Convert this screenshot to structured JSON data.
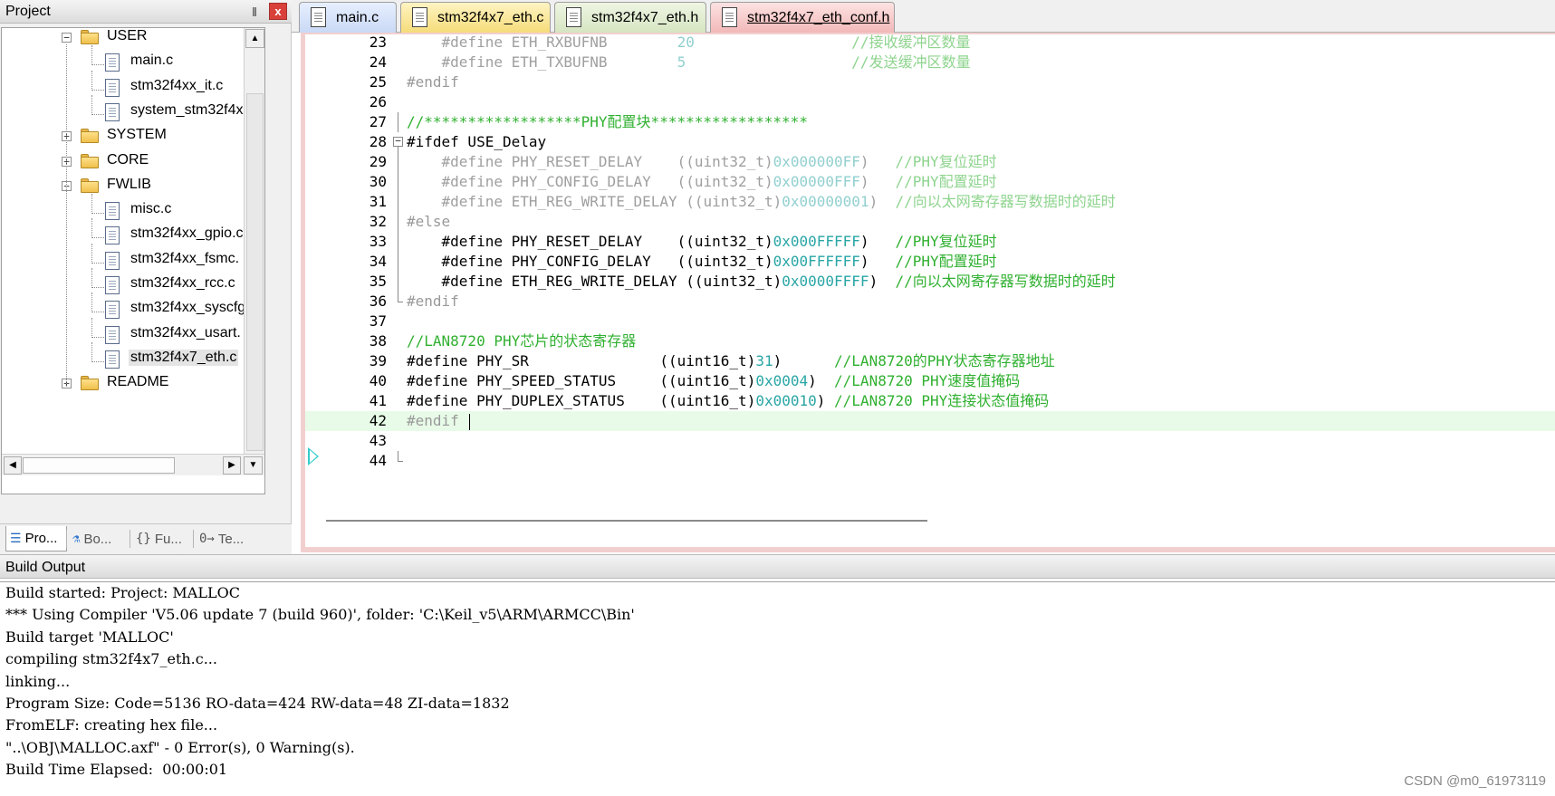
{
  "project_panel": {
    "title": "Project",
    "pin": "‖",
    "close": "x",
    "tree": [
      {
        "label": "USER",
        "type": "folder",
        "expanded": true
      },
      {
        "label": "main.c",
        "type": "file"
      },
      {
        "label": "stm32f4xx_it.c",
        "type": "file"
      },
      {
        "label": "system_stm32f4x",
        "type": "file"
      },
      {
        "label": "SYSTEM",
        "type": "folder",
        "expanded": false
      },
      {
        "label": "CORE",
        "type": "folder",
        "expanded": false
      },
      {
        "label": "FWLIB",
        "type": "folder",
        "expanded": true
      },
      {
        "label": "misc.c",
        "type": "file"
      },
      {
        "label": "stm32f4xx_gpio.c",
        "type": "file"
      },
      {
        "label": "stm32f4xx_fsmc.",
        "type": "file"
      },
      {
        "label": "stm32f4xx_rcc.c",
        "type": "file"
      },
      {
        "label": "stm32f4xx_syscfg",
        "type": "file"
      },
      {
        "label": "stm32f4xx_usart.",
        "type": "file"
      },
      {
        "label": "stm32f4x7_eth.c",
        "type": "file",
        "selected": true
      },
      {
        "label": "README",
        "type": "folder",
        "expanded": false
      }
    ],
    "bottom_tabs": [
      {
        "label": "Pro...",
        "icon": "project-icon",
        "active": true
      },
      {
        "label": "Bo...",
        "icon": "books-icon"
      },
      {
        "label": "Fu...",
        "icon": "functions-icon",
        "glyph": "{}"
      },
      {
        "label": "Te...",
        "icon": "templates-icon",
        "glyph": "0→"
      }
    ]
  },
  "editor": {
    "tabs": [
      {
        "label": "main.c"
      },
      {
        "label": "stm32f4x7_eth.c"
      },
      {
        "label": "stm32f4x7_eth.h"
      },
      {
        "label": "stm32f4x7_eth_conf.h",
        "active": true
      }
    ],
    "lines": [
      {
        "n": "23",
        "indent": "    ",
        "kw": "#define ETH_RXBUFNB",
        "pad": "        ",
        "val": "20",
        "pad2": "                  ",
        "cmt": "//接收缓冲区数量",
        "dim": true
      },
      {
        "n": "24",
        "indent": "    ",
        "kw": "#define ETH_TXBUFNB",
        "pad": "        ",
        "val": "5",
        "pad2": "                   ",
        "cmt": "//发送缓冲区数量",
        "dim": true
      },
      {
        "n": "25",
        "text": "#endif",
        "style": "pp"
      },
      {
        "n": "26",
        "text": ""
      },
      {
        "n": "27",
        "cmt": "//******************PHY配置块******************",
        "fold": "line"
      },
      {
        "n": "28",
        "text": "#ifdef USE_Delay",
        "style": "ppa",
        "fold": "box"
      },
      {
        "n": "29",
        "indent": "    ",
        "kw": "#define PHY_RESET_DELAY",
        "pad": "    ",
        "cast": "((uint32_t)",
        "val": "0x000000FF",
        "tail": ")",
        "pad2": "   ",
        "cmt": "//PHY复位延时",
        "dim": true,
        "fold": "line"
      },
      {
        "n": "30",
        "indent": "    ",
        "kw": "#define PHY_CONFIG_DELAY",
        "pad": "   ",
        "cast": "((uint32_t)",
        "val": "0x00000FFF",
        "tail": ")",
        "pad2": "   ",
        "cmt": "//PHY配置延时",
        "dim": true,
        "fold": "line"
      },
      {
        "n": "31",
        "indent": "    ",
        "kw": "#define ETH_REG_WRITE_DELAY",
        "pad": " ",
        "cast": "((uint32_t)",
        "val": "0x00000001",
        "tail": ")",
        "pad2": "  ",
        "cmt": "//向以太网寄存器写数据时的延时",
        "dim": true,
        "fold": "line"
      },
      {
        "n": "32",
        "text": "#else",
        "style": "pp",
        "fold": "line"
      },
      {
        "n": "33",
        "indent": "    ",
        "kw": "#define PHY_RESET_DELAY",
        "pad": "    ",
        "cast": "((uint32_t)",
        "val": "0x000FFFFF",
        "tail": ")",
        "pad2": "   ",
        "cmt": "//PHY复位延时",
        "fold": "line"
      },
      {
        "n": "34",
        "indent": "    ",
        "kw": "#define PHY_CONFIG_DELAY",
        "pad": "   ",
        "cast": "((uint32_t)",
        "val": "0x00FFFFFF",
        "tail": ")",
        "pad2": "   ",
        "cmt": "//PHY配置延时",
        "fold": "line"
      },
      {
        "n": "35",
        "indent": "    ",
        "kw": "#define ETH_REG_WRITE_DELAY",
        "pad": " ",
        "cast": "((uint32_t)",
        "val": "0x0000FFFF",
        "tail": ")",
        "pad2": "  ",
        "cmt": "//向以太网寄存器写数据时的延时",
        "fold": "line"
      },
      {
        "n": "36",
        "text": "#endif",
        "style": "pp",
        "fold": "end"
      },
      {
        "n": "37",
        "text": ""
      },
      {
        "n": "38",
        "cmt": "//LAN8720 PHY芯片的状态寄存器"
      },
      {
        "n": "39",
        "kw": "#define PHY_SR",
        "pad": "               ",
        "cast": "((uint16_t)",
        "val": "31",
        "tail": ")",
        "pad2": "      ",
        "cmt": "//LAN8720的PHY状态寄存器地址"
      },
      {
        "n": "40",
        "kw": "#define PHY_SPEED_STATUS",
        "pad": "     ",
        "cast": "((uint16_t)",
        "val": "0x0004",
        "tail": ")",
        "pad2": "  ",
        "cmt": "//LAN8720 PHY速度值掩码"
      },
      {
        "n": "41",
        "kw": "#define PHY_DUPLEX_STATUS",
        "pad": "    ",
        "cast": "((uint16_t)",
        "val": "0x00010",
        "tail": ")",
        "pad2": " ",
        "cmt": "//LAN8720 PHY连接状态值掩码"
      },
      {
        "n": "42",
        "text": "#endif",
        "style": "pp",
        "current": true,
        "caret": true
      },
      {
        "n": "43",
        "text": ""
      },
      {
        "n": "44",
        "text": "",
        "fold": "end"
      }
    ]
  },
  "build_output": {
    "title": "Build Output",
    "lines": [
      "Build started: Project: MALLOC",
      "*** Using Compiler 'V5.06 update 7 (build 960)', folder: 'C:\\Keil_v5\\ARM\\ARMCC\\Bin'",
      "Build target 'MALLOC'",
      "compiling stm32f4x7_eth.c...",
      "linking...",
      "Program Size: Code=5136 RO-data=424 RW-data=48 ZI-data=1832",
      "FromELF: creating hex file...",
      "\"..\\OBJ\\MALLOC.axf\" - 0 Error(s), 0 Warning(s).",
      "Build Time Elapsed:  00:00:01"
    ]
  },
  "watermark": "CSDN @m0_61973119"
}
